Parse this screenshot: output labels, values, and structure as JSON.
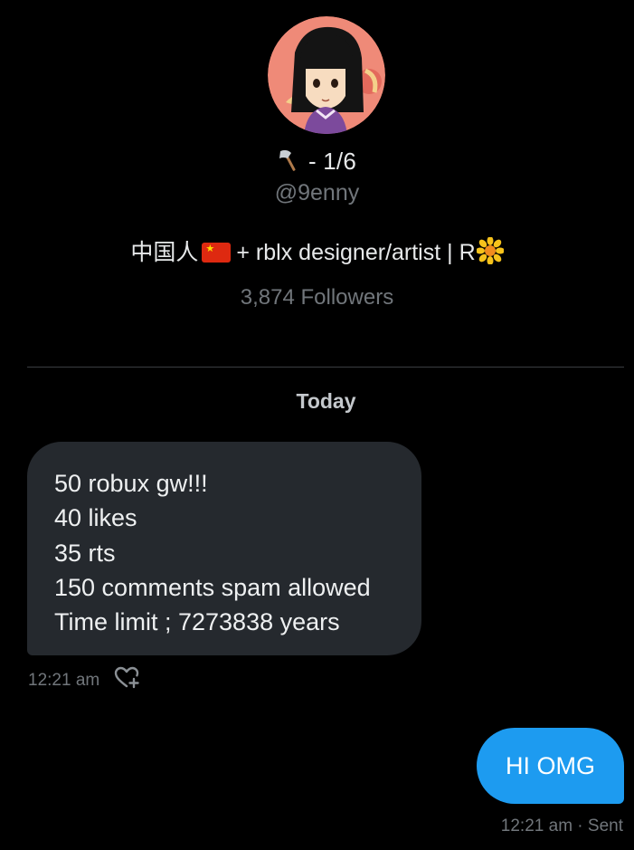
{
  "profile": {
    "display_name_suffix": "- 1/6",
    "display_name_icon": "axe-icon",
    "handle": "@9enny",
    "bio": {
      "prefix": "中国人",
      "flag_icon": "china-flag-icon",
      "middle": "+ rblx designer/artist | R",
      "end_icon": "sunflower-icon"
    },
    "followers": "3,874 Followers"
  },
  "conversation": {
    "date_label": "Today",
    "messages": [
      {
        "direction": "received",
        "lines": [
          "50 robux gw!!!",
          "40 likes",
          "35 rts",
          "150 comments spam allowed",
          "Time limit ; 7273838 years"
        ],
        "time": "12:21 am",
        "action_icon": "heart-plus-icon"
      },
      {
        "direction": "sent",
        "text": "HI OMG",
        "status": "12:21 am · Sent"
      }
    ]
  },
  "colors": {
    "background": "#000000",
    "received_bubble": "#25292e",
    "sent_bubble": "#1d9bf0",
    "muted_text": "#71767b"
  }
}
